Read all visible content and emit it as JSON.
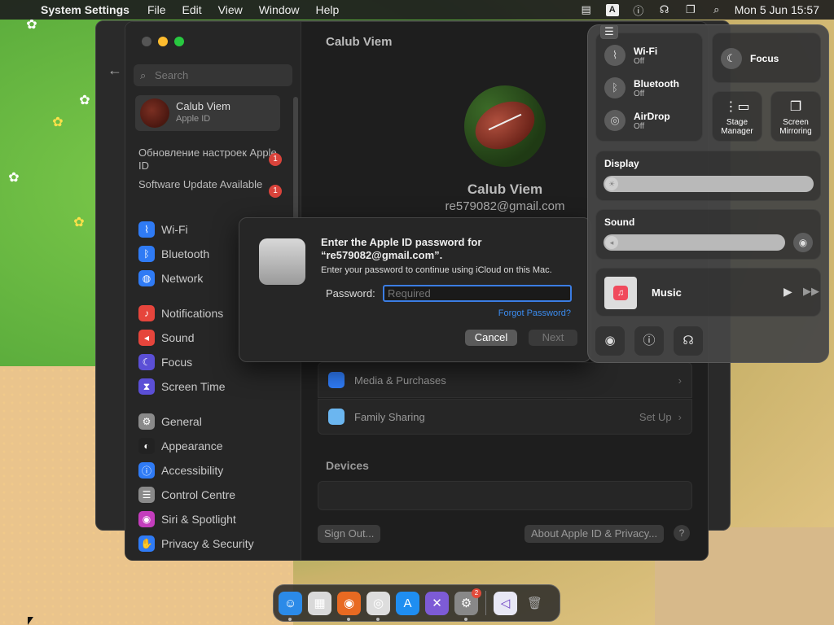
{
  "menubar": {
    "app_name": "System Settings",
    "menus": [
      "File",
      "Edit",
      "View",
      "Window",
      "Help"
    ],
    "input_source": "A",
    "clock": "Mon 5 Jun  15:57"
  },
  "sidebar": {
    "search_placeholder": "Search",
    "profile": {
      "name": "Calub Viem",
      "subtitle": "Apple ID"
    },
    "notices": [
      {
        "text": "Обновление настроек Apple ID",
        "badge": "1"
      },
      {
        "text": "Software Update Available",
        "badge": "1"
      }
    ],
    "items": [
      {
        "label": "Wi-Fi",
        "color": "#2f7bf5",
        "icon": "wifi-icon"
      },
      {
        "label": "Bluetooth",
        "color": "#2f7bf5",
        "icon": "bluetooth-icon"
      },
      {
        "label": "Network",
        "color": "#2f7bf5",
        "icon": "globe-icon"
      },
      {
        "label": "Notifications",
        "color": "#e6453c",
        "icon": "bell-icon"
      },
      {
        "label": "Sound",
        "color": "#e6453c",
        "icon": "speaker-icon"
      },
      {
        "label": "Focus",
        "color": "#5b4fd6",
        "icon": "moon-icon"
      },
      {
        "label": "Screen Time",
        "color": "#5b4fd6",
        "icon": "hourglass-icon"
      },
      {
        "label": "General",
        "color": "#8a8a8a",
        "icon": "gear-icon"
      },
      {
        "label": "Appearance",
        "color": "#222222",
        "icon": "appearance-icon"
      },
      {
        "label": "Accessibility",
        "color": "#2f7bf5",
        "icon": "accessibility-icon"
      },
      {
        "label": "Control Centre",
        "color": "#8a8a8a",
        "icon": "control-centre-icon"
      },
      {
        "label": "Siri & Spotlight",
        "color": "#c43dbd",
        "icon": "siri-icon"
      },
      {
        "label": "Privacy & Security",
        "color": "#2f7bf5",
        "icon": "hand-icon"
      }
    ]
  },
  "content": {
    "title": "Calub Viem",
    "name": "Calub Viem",
    "email": "re579082@gmail.com",
    "rows": [
      {
        "label": "Media & Purchases",
        "value": ""
      },
      {
        "label": "Family Sharing",
        "value": "Set Up"
      }
    ],
    "devices_title": "Devices",
    "sign_out": "Sign Out...",
    "about": "About Apple ID & Privacy...",
    "help": "?"
  },
  "dialog": {
    "heading": "Enter the Apple ID password for “re579082@gmail.com”.",
    "body": "Enter your password to continue using iCloud on this Mac.",
    "password_label": "Password:",
    "password_placeholder": "Required",
    "forgot": "Forgot Password?",
    "cancel": "Cancel",
    "next": "Next"
  },
  "control_centre": {
    "wifi": {
      "label": "Wi-Fi",
      "state": "Off"
    },
    "bluetooth": {
      "label": "Bluetooth",
      "state": "Off"
    },
    "airdrop": {
      "label": "AirDrop",
      "state": "Off"
    },
    "focus": "Focus",
    "stage_manager": "Stage Manager",
    "screen_mirroring": "Screen Mirroring",
    "display": "Display",
    "sound": "Sound",
    "music": "Music"
  },
  "dock": {
    "apps": [
      {
        "name": "finder",
        "color": "#2b8ae8",
        "glyph": "☺"
      },
      {
        "name": "launchpad",
        "color": "#d9d9d9",
        "glyph": "▦"
      },
      {
        "name": "firefox",
        "color": "#e86a22",
        "glyph": "◉"
      },
      {
        "name": "chrome",
        "color": "#dddddd",
        "glyph": "◎"
      },
      {
        "name": "app-store",
        "color": "#1f8ef1",
        "glyph": "A"
      },
      {
        "name": "xcode-tool",
        "color": "#7d5bd6",
        "glyph": "✕"
      },
      {
        "name": "system-settings",
        "color": "#888888",
        "glyph": "⚙"
      }
    ],
    "settings_badge": "2"
  }
}
